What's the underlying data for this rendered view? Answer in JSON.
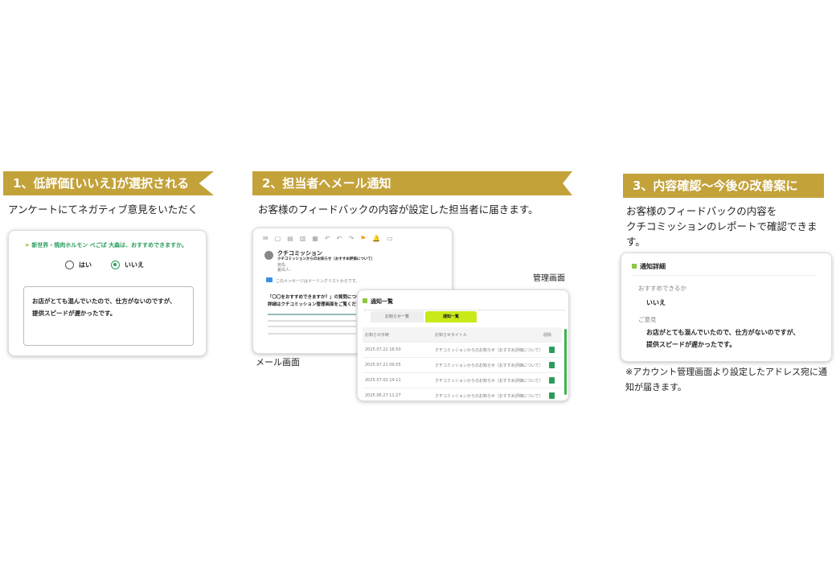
{
  "step1": {
    "title": "1、低評価[いいえ]が選択される",
    "desc": "アンケートにてネガティブ意見をいただく",
    "question": "新世界・焼肉ホルモン べごば 大森は、おすすめできますか。",
    "yes": "はい",
    "no": "いいえ",
    "comment_line1": "お店がとても混んでいたので、仕方がないのですが、",
    "comment_line2": "提供スピードが遅かったです。"
  },
  "step2": {
    "title": "2、担当者へメール通知",
    "desc": "お客様のフィードバックの内容が設定した担当者に届きます。",
    "mail": {
      "sender": "クチコミッション",
      "subject": "クチコミッションからのお知らせ（おすすめ評価について）",
      "to_label": "宛先:",
      "cc_label": "差出人:",
      "notice": "このメッセージはメーリングリストからです。",
      "body_line1": "「〇〇をおすすめできますか？」の質問について「いいえ」",
      "body_line2": "詳細はクチコミッション管理画面をご覧ください。",
      "caption": "メール画面"
    },
    "admin": {
      "caption": "管理画面",
      "title": "通知一覧",
      "tab1": "お知らせ一覧",
      "tab2": "通知一覧",
      "columns": [
        "お知らせ日時",
        "お知らせタイトル",
        "削除"
      ],
      "rows": [
        {
          "date": "2025.07.22 16:50",
          "title": "クチコミッションからのお知らせ（おすすめ評価について）"
        },
        {
          "date": "2025.07.21 09:55",
          "title": "クチコミッションからのお知らせ（おすすめ評価について）"
        },
        {
          "date": "2025.07.02 14:11",
          "title": "クチコミッションからのお知らせ（おすすめ評価について）"
        },
        {
          "date": "2025.06.27 11:27",
          "title": "クチコミッションからのお知らせ（おすすめ評価について）"
        }
      ]
    }
  },
  "step3": {
    "title": "3、内容確認〜今後の改善案に",
    "desc_line1": "お客様のフィードバックの内容を",
    "desc_line2": "クチコミッションのレポートで確認できま",
    "desc_line3": "す。",
    "detail_title": "通知詳細",
    "q_label": "おすすめできるか",
    "q_value": "いいえ",
    "c_label": "ご意見",
    "c_line1": "お店がとても混んでいたので、仕方がないのですが、",
    "c_line2": "提供スピードが遅かったです。",
    "note_line1": "※アカウント管理画面より設定したアドレス宛に通",
    "note_line2": "知が届きます。"
  }
}
